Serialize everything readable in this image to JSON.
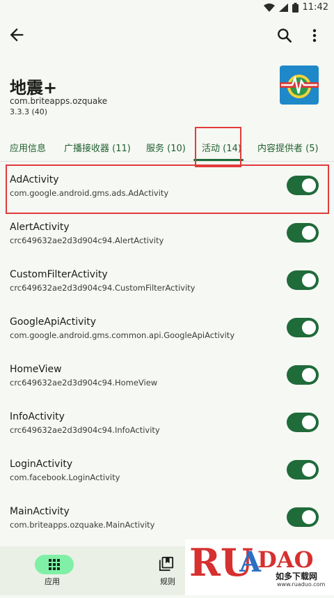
{
  "status_bar": {
    "time": "11:42"
  },
  "app": {
    "title": "地震+",
    "package": "com.briteapps.ozquake",
    "version": "3.3.3 (40)"
  },
  "tabs": [
    {
      "label": "应用信息"
    },
    {
      "label": "广播接收器 (11)"
    },
    {
      "label": "服务 (10)"
    },
    {
      "label": "活动 (14)"
    },
    {
      "label": "内容提供者 (5)"
    }
  ],
  "activities": [
    {
      "name": "AdActivity",
      "class": "com.google.android.gms.ads.AdActivity",
      "enabled": true
    },
    {
      "name": "AlertActivity",
      "class": "crc649632ae2d3d904c94.AlertActivity",
      "enabled": true
    },
    {
      "name": "CustomFilterActivity",
      "class": "crc649632ae2d3d904c94.CustomFilterActivity",
      "enabled": true
    },
    {
      "name": "GoogleApiActivity",
      "class": "com.google.android.gms.common.api.GoogleApiActivity",
      "enabled": true
    },
    {
      "name": "HomeView",
      "class": "crc649632ae2d3d904c94.HomeView",
      "enabled": true
    },
    {
      "name": "InfoActivity",
      "class": "crc649632ae2d3d904c94.InfoActivity",
      "enabled": true
    },
    {
      "name": "LoginActivity",
      "class": "com.facebook.LoginActivity",
      "enabled": true
    },
    {
      "name": "MainActivity",
      "class": "com.briteapps.ozquake.MainActivity",
      "enabled": true
    }
  ],
  "bottom_nav": [
    {
      "label": "应用"
    },
    {
      "label": "规则"
    }
  ],
  "watermark": {
    "logo": "RUANDAO",
    "subtitle": "如多下载网",
    "url": "www.ruaduo.com"
  },
  "colors": {
    "accent": "#1f6b3a",
    "highlight": "#e23b3b",
    "nav_pill": "#7ff0a6"
  }
}
